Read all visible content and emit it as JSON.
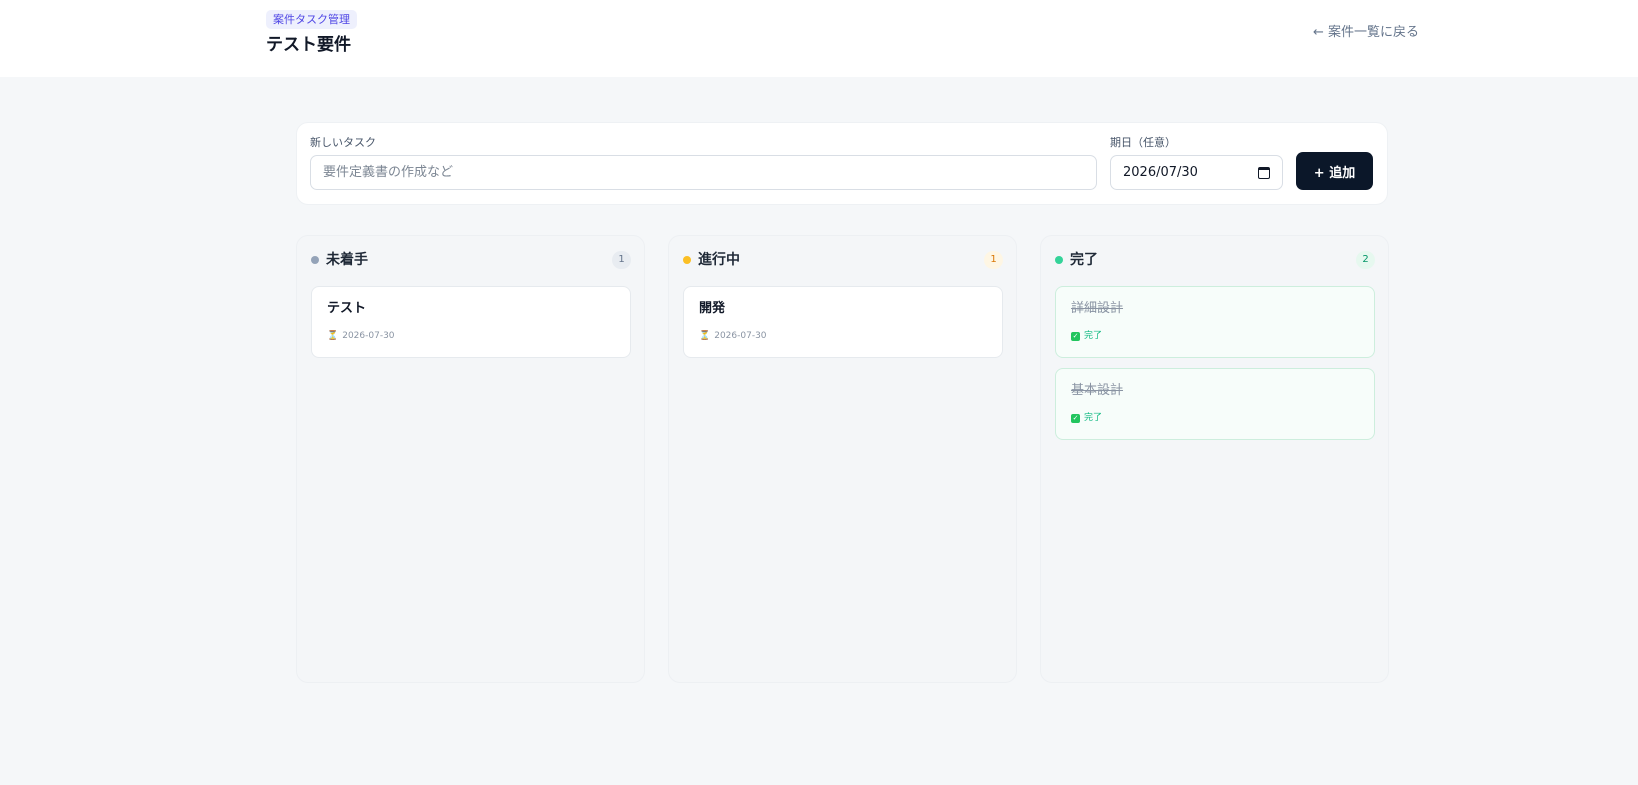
{
  "header": {
    "badge": "案件タスク管理",
    "title": "テスト要件",
    "back_link": "← 案件一覧に戻る"
  },
  "form": {
    "task_label": "新しいタスク",
    "task_placeholder": "要件定義書の作成など",
    "task_value": "",
    "date_label": "期日（任意）",
    "date_value": "2026/07/30",
    "add_label": "+ 追加"
  },
  "columns": [
    {
      "title": "未着手",
      "count": "1",
      "dot_color": "#94a3b8",
      "count_bg": "#e8ecf1",
      "count_color": "#64748b",
      "cards": [
        {
          "title": "テスト",
          "meta": "2026-07-30",
          "icon": "hourglass-icon"
        }
      ]
    },
    {
      "title": "進行中",
      "count": "1",
      "dot_color": "#fbbf24",
      "count_bg": "#fef6e4",
      "count_color": "#d97706",
      "cards": [
        {
          "title": "開発",
          "meta": "2026-07-30",
          "icon": "hourglass-icon"
        }
      ]
    },
    {
      "title": "完了",
      "count": "2",
      "dot_color": "#34d399",
      "count_bg": "#e6f8ef",
      "count_color": "#059669",
      "cards": [
        {
          "title": "詳細設計",
          "meta": "完了",
          "icon": "check-icon"
        },
        {
          "title": "基本設計",
          "meta": "完了",
          "icon": "check-icon"
        }
      ]
    }
  ]
}
